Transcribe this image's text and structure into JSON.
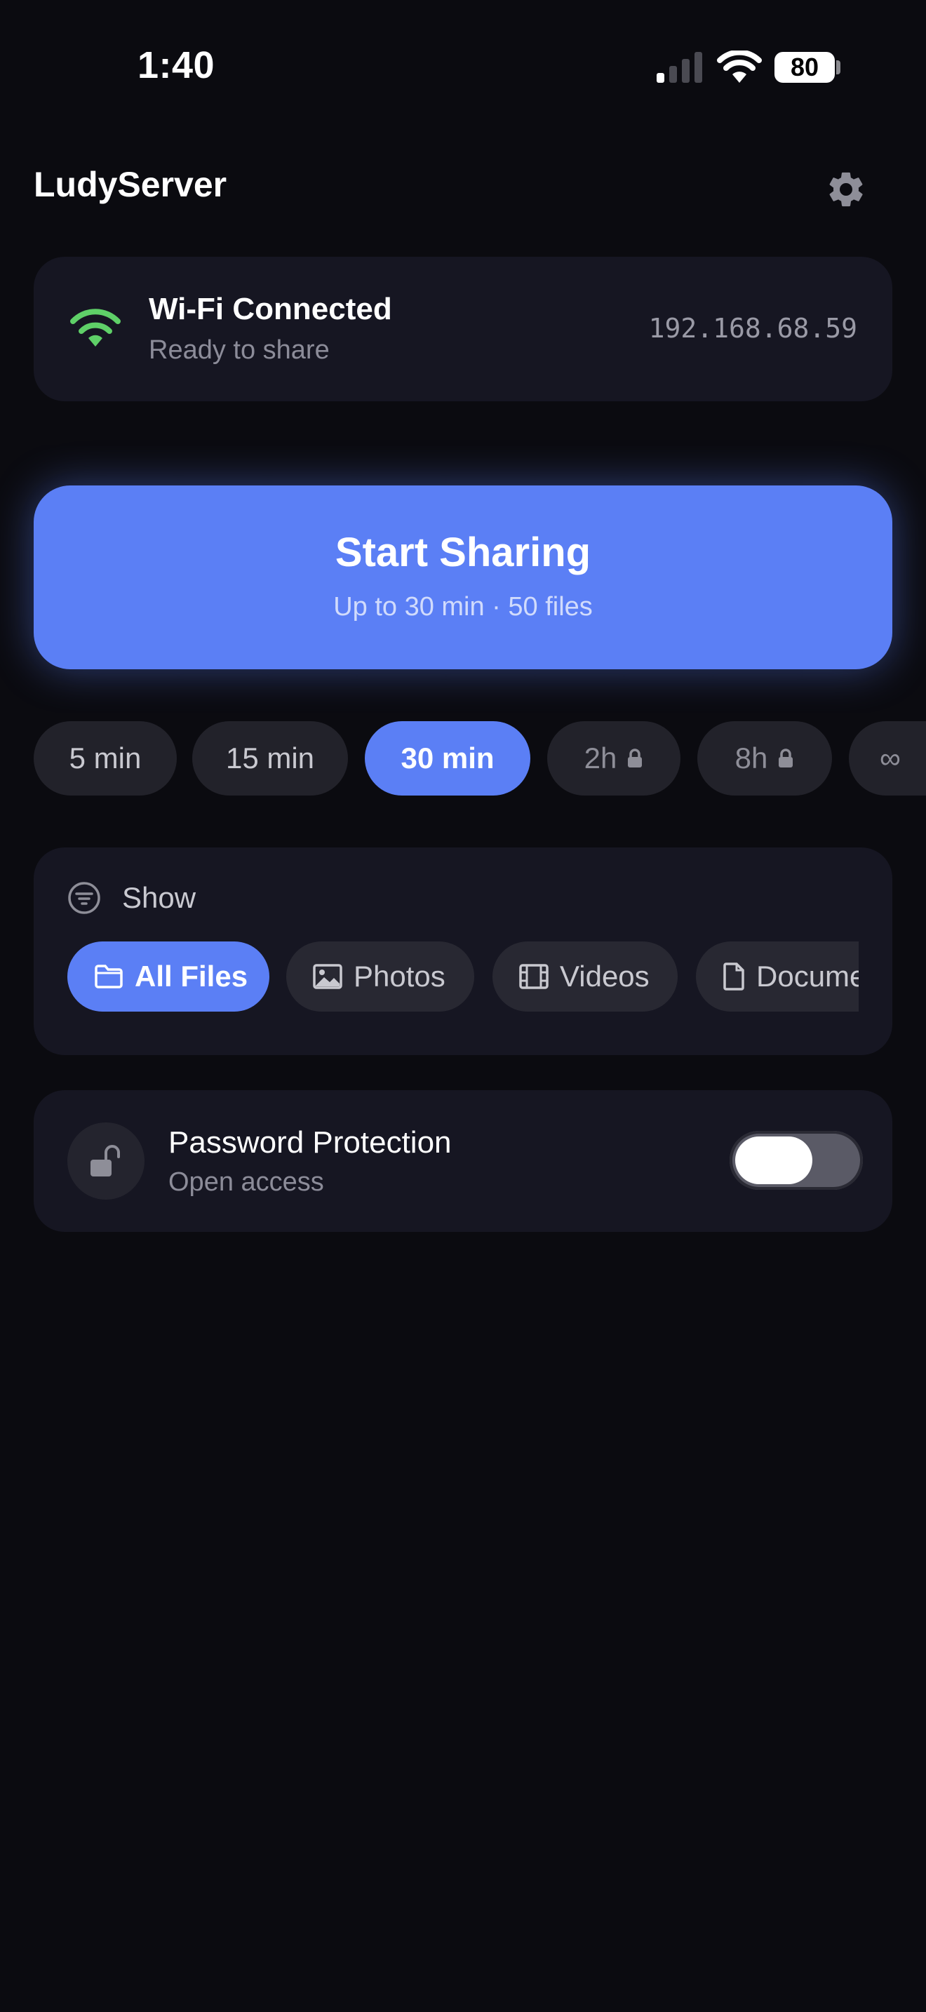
{
  "status_bar": {
    "time": "1:40",
    "battery": "80"
  },
  "header": {
    "title": "LudyServer",
    "settings_icon": "gear-icon"
  },
  "wifi": {
    "title": "Wi-Fi Connected",
    "subtitle": "Ready to share",
    "ip": "192.168.68.59",
    "icon": "wifi-icon",
    "icon_color": "#5fd068"
  },
  "share": {
    "title": "Start Sharing",
    "subtitle": "Up to 30 min · 50 files",
    "color": "#5b7ff5"
  },
  "durations": [
    {
      "label": "5 min",
      "active": false,
      "locked": false
    },
    {
      "label": "15 min",
      "active": false,
      "locked": false
    },
    {
      "label": "30 min",
      "active": true,
      "locked": false
    },
    {
      "label": "2h",
      "active": false,
      "locked": true
    },
    {
      "label": "8h",
      "active": false,
      "locked": true
    },
    {
      "label": "∞",
      "active": false,
      "locked": true
    }
  ],
  "filter": {
    "label": "Show",
    "options": [
      {
        "label": "All Files",
        "icon": "folder-icon",
        "active": true
      },
      {
        "label": "Photos",
        "icon": "image-icon",
        "active": false
      },
      {
        "label": "Videos",
        "icon": "film-icon",
        "active": false
      },
      {
        "label": "Documents",
        "icon": "document-icon",
        "active": false
      }
    ]
  },
  "password": {
    "title": "Password Protection",
    "subtitle": "Open access",
    "icon": "unlock-icon",
    "enabled": false
  }
}
